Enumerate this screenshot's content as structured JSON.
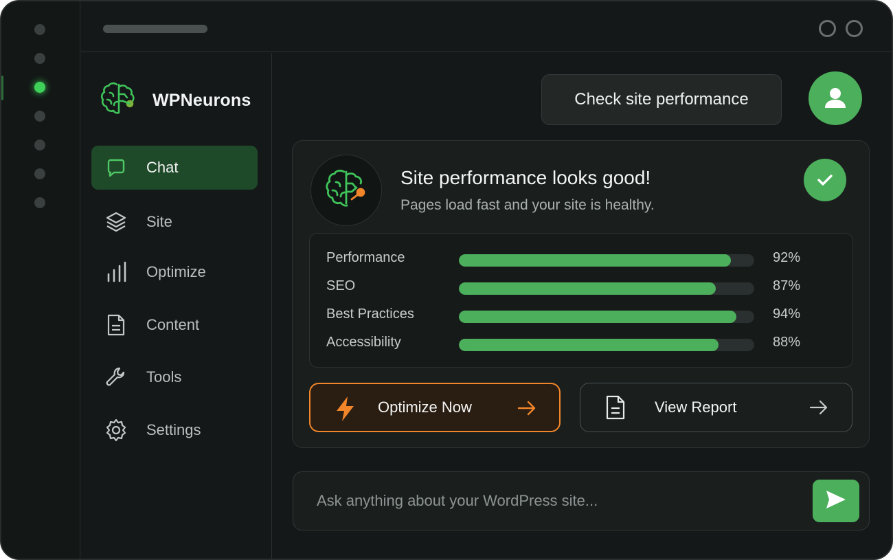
{
  "app": {
    "brand_name": "WPNeurons",
    "brand_icon": "brain-circuit-icon"
  },
  "rail": {
    "dots": 7,
    "active_index": 2,
    "active_color": "#3fd05a"
  },
  "sidebar": {
    "items": [
      {
        "label": "Chat",
        "icon": "chat-bubble-icon",
        "active": true
      },
      {
        "label": "Site",
        "icon": "layers-icon",
        "active": false
      },
      {
        "label": "Optimize",
        "icon": "bar-chart-icon",
        "active": false
      },
      {
        "label": "Content",
        "icon": "document-icon",
        "active": false
      },
      {
        "label": "Tools",
        "icon": "wrench-icon",
        "active": false
      },
      {
        "label": "Settings",
        "icon": "gear-icon",
        "active": false
      }
    ]
  },
  "header": {
    "prompt_label": "Check site performance",
    "avatar_icon": "user-icon"
  },
  "result": {
    "title": "Site performance looks good!",
    "subtitle": "Pages load fast and your site is healthy.",
    "status_icon": "check-icon",
    "metrics": [
      {
        "label": "Performance",
        "value": "92%",
        "fraction": 0.92
      },
      {
        "label": "SEO",
        "value": "87%",
        "fraction": 0.87
      },
      {
        "label": "Best Practices",
        "value": "94%",
        "fraction": 0.94
      },
      {
        "label": "Accessibility",
        "value": "88%",
        "fraction": 0.88
      }
    ],
    "optimize_label": "Optimize Now",
    "report_label": "View Report"
  },
  "composer": {
    "placeholder": "Ask anything about your WordPress site...",
    "send_icon": "send-icon"
  },
  "colors": {
    "accent_green": "#4caf5c",
    "accent_orange": "#f0852a",
    "background": "#141818"
  }
}
